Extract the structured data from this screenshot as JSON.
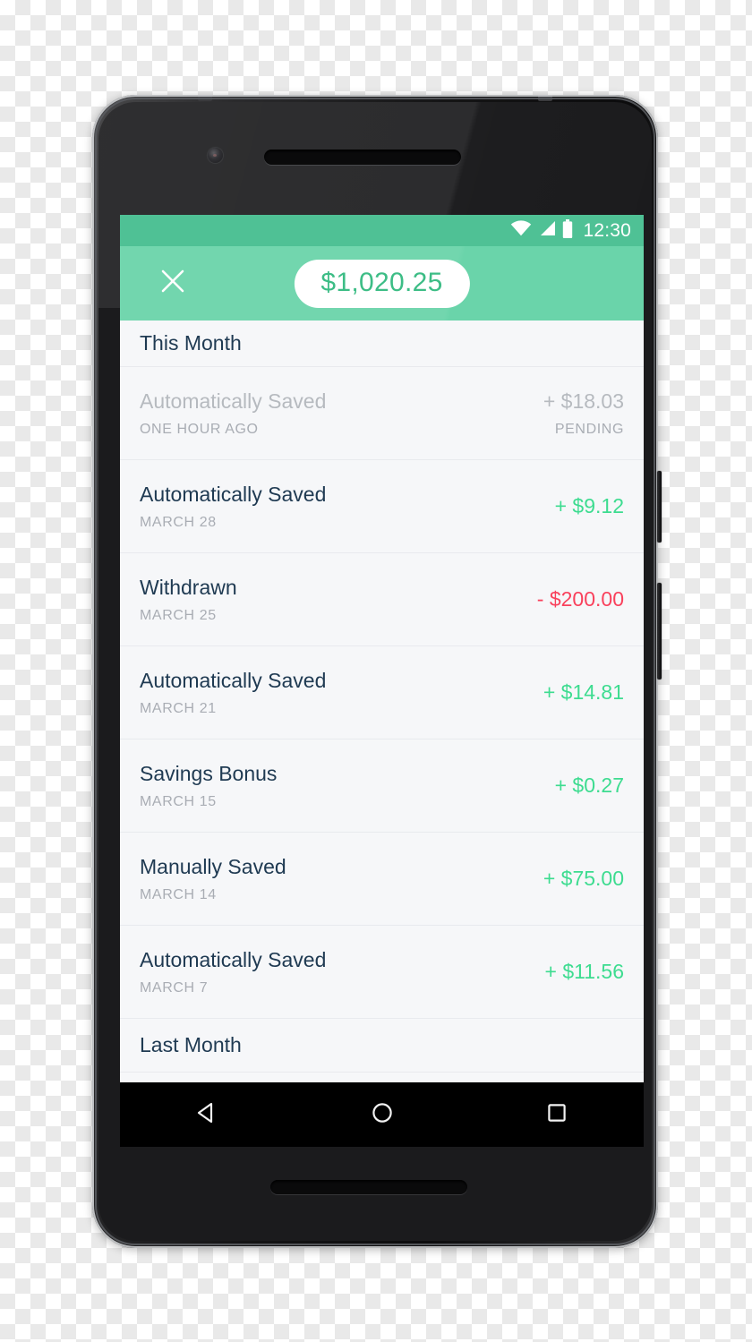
{
  "device": {
    "hardware": {
      "front_camera": "front-camera",
      "earpiece": "earpiece-speaker",
      "bottom_speaker": "bottom-speaker",
      "power_button": "power-button",
      "volume_button": "volume-button"
    }
  },
  "status_bar": {
    "time": "12:30",
    "icons": [
      "wifi-icon",
      "cell-signal-icon",
      "battery-icon"
    ],
    "background": "#4fc195"
  },
  "app_bar": {
    "close_label": "close-icon",
    "balance": "$1,020.25",
    "background": "#6ad4aa",
    "balance_text_color": "#3dbd86"
  },
  "colors": {
    "credit": "#3ddc90",
    "debit": "#f9415c",
    "muted": "#b6babf",
    "title": "#1f3a52",
    "date": "#a9adb4",
    "screen_bg": "#f6f7f9",
    "divider": "#e8eaee"
  },
  "sections": [
    {
      "header": "This Month",
      "rows": [
        {
          "title": "Automatically Saved",
          "date": "ONE HOUR AGO",
          "amount": "+ $18.03",
          "status": "PENDING",
          "kind": "pending"
        },
        {
          "title": "Automatically Saved",
          "date": "MARCH 28",
          "amount": "+ $9.12",
          "status": "",
          "kind": "credit"
        },
        {
          "title": "Withdrawn",
          "date": "MARCH 25",
          "amount": "- $200.00",
          "status": "",
          "kind": "debit"
        },
        {
          "title": "Automatically Saved",
          "date": "MARCH 21",
          "amount": "+ $14.81",
          "status": "",
          "kind": "credit"
        },
        {
          "title": "Savings Bonus",
          "date": "MARCH 15",
          "amount": "+ $0.27",
          "status": "",
          "kind": "credit"
        },
        {
          "title": "Manually Saved",
          "date": "MARCH 14",
          "amount": "+ $75.00",
          "status": "",
          "kind": "credit"
        },
        {
          "title": "Automatically Saved",
          "date": "MARCH 7",
          "amount": "+ $11.56",
          "status": "",
          "kind": "credit"
        }
      ]
    },
    {
      "header": "Last Month",
      "rows": []
    }
  ],
  "nav_bar": {
    "back": "back-triangle-icon",
    "home": "home-circle-icon",
    "recents": "recents-square-icon"
  }
}
